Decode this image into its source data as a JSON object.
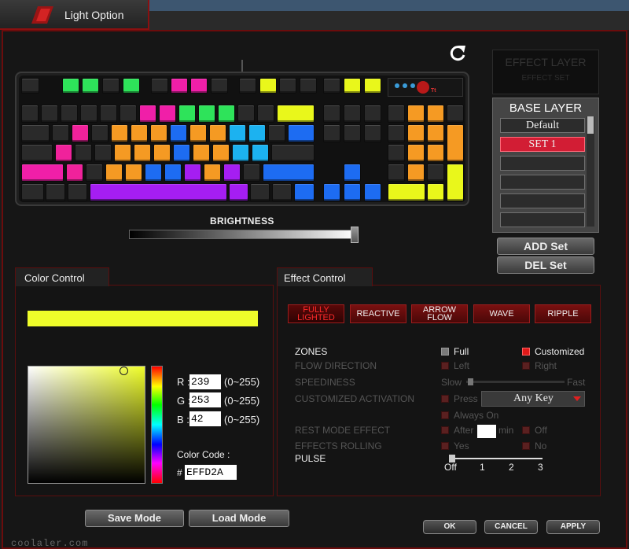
{
  "window": {
    "tab_title": "Light Option"
  },
  "keyboard": {
    "key_colors": {
      "off": "#2a2a2a",
      "green": "#2ee35a",
      "magenta": "#f01fa8",
      "yellow": "#e9f71b",
      "orange": "#f59a23",
      "blue": "#1d6cf2",
      "cyan": "#1cb2f0",
      "purple": "#a51ef2",
      "pink": "#f0229b"
    },
    "brand_text": "Tt"
  },
  "brightness": {
    "label": "BRIGHTNESS",
    "level_percent": 100
  },
  "effect_layer": {
    "title": "EFFECT LAYER",
    "set_label": "EFFECT SET"
  },
  "base_layer": {
    "title": "BASE LAYER",
    "sets": [
      "Default",
      "SET 1",
      "",
      "",
      "",
      ""
    ],
    "selected_index": 1,
    "add_label": "ADD Set",
    "del_label": "DEL Set"
  },
  "color_control": {
    "title": "Color Control",
    "current_color": "#EFFD2A",
    "r_label": "R :",
    "g_label": "G :",
    "b_label": "B :",
    "r": "239",
    "g": "253",
    "b": "42",
    "range": "(0~255)",
    "code_label": "Color Code :",
    "hash": "#",
    "code": "EFFD2A"
  },
  "effect_control": {
    "title": "Effect Control",
    "buttons": [
      "FULLY LIGHTED",
      "REACTIVE",
      "ARROW FLOW",
      "WAVE",
      "RIPPLE"
    ],
    "active_button": "FULLY LIGHTED",
    "zones": {
      "label": "ZONES",
      "full": "Full",
      "customized": "Customized"
    },
    "flow_direction": {
      "label": "FLOW DIRECTION",
      "left": "Left",
      "right": "Right"
    },
    "speediness": {
      "label": "SPEEDINESS",
      "slow": "Slow",
      "fast": "Fast"
    },
    "customized_activation": {
      "label": "CUSTOMIZED ACTIVATION",
      "press": "Press",
      "key": "Any Key",
      "always_on": "Always On"
    },
    "rest_mode": {
      "label": "REST MODE EFFECT",
      "after": "After",
      "min": "min",
      "off": "Off"
    },
    "effects_rolling": {
      "label": "EFFECTS ROLLING",
      "yes": "Yes",
      "no": "No"
    },
    "pulse": {
      "label": "PULSE",
      "ticks": [
        "Off",
        "1",
        "2",
        "3"
      ],
      "value": "Off"
    }
  },
  "bottom": {
    "save_mode": "Save Mode",
    "load_mode": "Load Mode",
    "ok": "OK",
    "cancel": "CANCEL",
    "apply": "APPLY",
    "watermark": "coolaler.com"
  }
}
